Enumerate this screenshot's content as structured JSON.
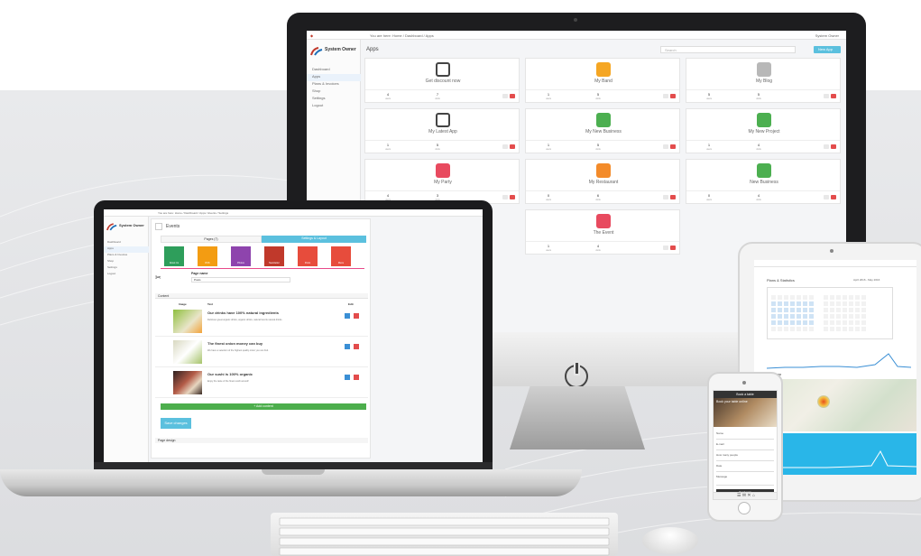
{
  "imac": {
    "breadcrumb": "You are here: Home / Dashboard / Apps",
    "owner": "System Owner",
    "page_title": "Apps",
    "search_placeholder": "Search",
    "new_app_button": "New App",
    "sidebar": [
      "Dashboard",
      "Apps",
      "Plans & Invoices",
      "Shop",
      "Settings",
      "Logout"
    ],
    "apps": [
      {
        "name": "Get discount now",
        "users": "4",
        "visits": "7",
        "color": "#ffffff"
      },
      {
        "name": "My Band",
        "users": "1",
        "visits": "5",
        "color": "#f5a623"
      },
      {
        "name": "My Blog",
        "users": "5",
        "visits": "5",
        "color": "#b8b8b8"
      },
      {
        "name": "My Latest App",
        "users": "1",
        "visits": "5",
        "color": "#ffffff"
      },
      {
        "name": "My New Business",
        "users": "1",
        "visits": "5",
        "color": "#4caf50"
      },
      {
        "name": "My New Project",
        "users": "1",
        "visits": "4",
        "color": "#4caf50"
      },
      {
        "name": "My Party",
        "users": "4",
        "visits": "3",
        "color": "#e84a5f"
      },
      {
        "name": "My Restaurant",
        "users": "0",
        "visits": "6",
        "color": "#f38b2a"
      },
      {
        "name": "New Business",
        "users": "0",
        "visits": "4",
        "color": "#4caf50"
      },
      {
        "name": "The Event",
        "users": "1",
        "visits": "4",
        "color": "#e84a5f"
      }
    ],
    "stat_users_label": "users",
    "stat_visits_label": "visits"
  },
  "laptop": {
    "owner": "System Owner",
    "breadcrumb": "You are here: Home / Dashboard / Apps / Events / Settings",
    "page_title": "Events",
    "page_name_label": "Page name",
    "page_name_value": "Posts",
    "content_header": "Content",
    "col_image": "Image",
    "col_text": "Text",
    "col_edit": "Edit",
    "posts": [
      {
        "title": "Our drinks have 100% natural ingredients",
        "text": "Delicious great organic drinks, organic drinks, natural food & natural drinks."
      },
      {
        "title": "The finest onion money can buy",
        "text": "We have a selection of the highest quality onion you can find."
      },
      {
        "title": "Our sushi is 100% organic",
        "text": "Enjoy the taste of the finest sushi around!"
      }
    ],
    "add_button": "+ Add content",
    "save_button": "Save changes",
    "page_design": "Page design",
    "tiles": [
      "About Us",
      "RSS",
      "Photos",
      "Newsletter",
      "Posts",
      "Menu"
    ],
    "tile_colors": [
      "#2e9e5b",
      "#f39c12",
      "#8e44ad",
      "#c0392b",
      "#e74c3c",
      "#e74c3c"
    ],
    "pages_tab": "Pages (7)",
    "settings_tab": "Settings & Layout"
  },
  "phone1": {
    "title": "Events",
    "post_title": "Our sushi is 100% organic",
    "post_text": "Enjoy the taste of the finest sushi around!"
  },
  "tablet": {
    "title": "Plans & Statistics",
    "heatmap_label": "Heatmap",
    "visits_label": "Visits",
    "date_range": "April 2016 - May 2016"
  },
  "phone2": {
    "title": "Book a table",
    "heading": "Book your table online",
    "field_name": "Name",
    "field_email": "E-mail",
    "field_people": "How many people",
    "field_date": "Date",
    "field_message": "Message",
    "submit": "Send now"
  }
}
